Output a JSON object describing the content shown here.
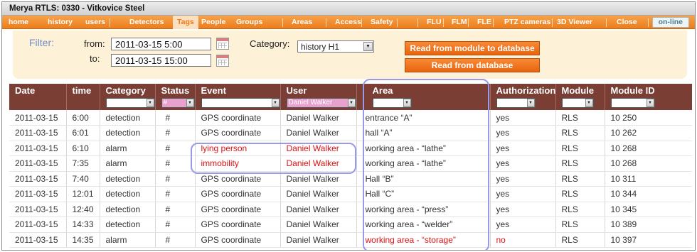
{
  "window": {
    "title": "Merya RTLS:  0330 - Vitkovice Steel"
  },
  "nav": {
    "items": [
      "home",
      "history",
      "users",
      "Detectors",
      "Tags",
      "People",
      "Groups",
      "Areas",
      "Access",
      "Safety",
      "FLU",
      "FLM",
      "FLE",
      "PTZ cameras",
      "3D Viewer",
      "Close"
    ],
    "active": "Tags",
    "status": "on-line"
  },
  "filter": {
    "label": "Filter:",
    "from_label": "from:",
    "to_label": "to:",
    "from_value": "2011-03-15   5:00",
    "to_value": "2011-03-15   15:00",
    "category_label": "Category:",
    "category_value": "history H1",
    "btn_read_module": "Read from module to database",
    "btn_read_db": "Read from database"
  },
  "table": {
    "columns": [
      "Date",
      "time",
      "Category",
      "Status",
      "Event",
      "User",
      "Area",
      "Authorization",
      "Module",
      "Module ID"
    ],
    "status_filter": "#",
    "user_filter": "Daniel Walker",
    "rows": [
      [
        "2011-03-15",
        "6:00",
        "detection",
        "#",
        "GPS coordinate",
        "Daniel Walker",
        "entrance “A”",
        "yes",
        "RLS",
        "10 250"
      ],
      [
        "2011-03-15",
        "6:01",
        "detection",
        "#",
        "GPS coordinate",
        "Daniel Walker",
        "hall “A”",
        "yes",
        "RLS",
        "10 262"
      ],
      [
        "2011-03-15",
        "6:10",
        "alarm",
        "#",
        "lying person",
        "Daniel Walker",
        "working area - “lathe”",
        "yes",
        "RLS",
        "10 268"
      ],
      [
        "2011-03-15",
        "7:35",
        "alarm",
        "#",
        "immobility",
        "Daniel Walker",
        "working area - “lathe”",
        "yes",
        "RLS",
        "10 268"
      ],
      [
        "2011-03-15",
        "7:40",
        "detection",
        "#",
        "GPS coordinate",
        "Daniel Walker",
        "Hall “B”",
        "yes",
        "RLS",
        "10 311"
      ],
      [
        "2011-03-15",
        "12:01",
        "detection",
        "#",
        "GPS coordinate",
        "Daniel Walker",
        "Hall “C”",
        "yes",
        "RLS",
        "10 344"
      ],
      [
        "2011-03-15",
        "12:40",
        "detection",
        "#",
        "GPS coordinate",
        "Daniel Walker",
        "working area - “press”",
        "yes",
        "RLS",
        "10 345"
      ],
      [
        "2011-03-15",
        "14:33",
        "detection",
        "#",
        "GPS coordinate",
        "Daniel Walker",
        "working area - “welder”",
        "yes",
        "RLS",
        "10 389"
      ],
      [
        "2011-03-15",
        "14:35",
        "alarm",
        "#",
        "GPS coordinate",
        "Daniel Walker",
        "working area - “storage”",
        "no",
        "RLS",
        "10 397"
      ]
    ],
    "red_cells": [
      [
        2,
        4
      ],
      [
        2,
        5
      ],
      [
        3,
        4
      ],
      [
        3,
        5
      ],
      [
        8,
        6
      ],
      [
        8,
        7
      ]
    ]
  },
  "colors": {
    "nav_orange": "#ec7d1c",
    "table_header": "#7a3e34",
    "alert_red": "#dd1111",
    "highlight": "#9999e6"
  }
}
